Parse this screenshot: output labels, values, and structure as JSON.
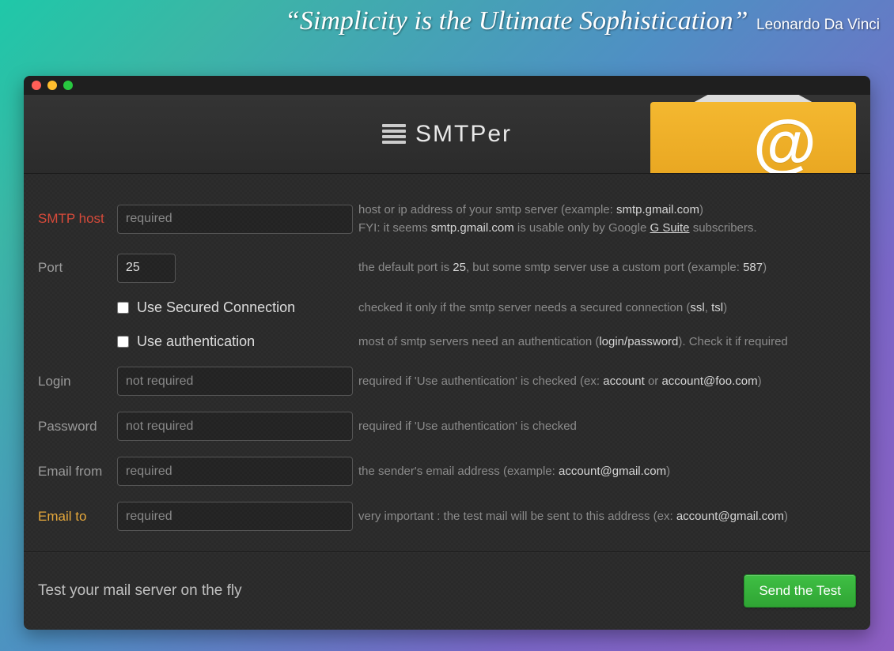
{
  "quote": {
    "text": "“Simplicity is the Ultimate Sophistication”",
    "author": "Leonardo Da Vinci"
  },
  "brand": {
    "name_html_prefix": "SMT",
    "name_html_suffix": "Per"
  },
  "icons": {
    "envelope_glyph": "@"
  },
  "fields": {
    "smtp_host": {
      "label": "SMTP host",
      "placeholder": "required",
      "help_pre": "host or ip address of your smtp server (example: ",
      "help_ex": "smtp.gmail.com",
      "help_post": ")",
      "fyi_pre": "FYI: it seems ",
      "fyi_host": "smtp.gmail.com",
      "fyi_mid": " is usable only by Google ",
      "fyi_link": "G Suite",
      "fyi_post": " subscribers."
    },
    "port": {
      "label": "Port",
      "value": "25",
      "help_pre": "the default port is ",
      "help_25": "25",
      "help_mid": ", but some smtp server use a custom port (example: ",
      "help_587": "587",
      "help_post": ")"
    },
    "secure": {
      "label": "Use Secured Connection",
      "help_pre": "checked it only if the smtp server needs a secured connection (",
      "help_ssl": "ssl",
      "help_sep": ", ",
      "help_tsl": "tsl",
      "help_post": ")"
    },
    "auth": {
      "label": "Use authentication",
      "help_pre": "most of smtp servers need an authentication (",
      "help_lp": "login/password",
      "help_post": "). Check it if required"
    },
    "login": {
      "label": "Login",
      "placeholder": "not required",
      "help_pre": "required if 'Use authentication' is checked (ex: ",
      "help_ex1": "account",
      "help_or": " or ",
      "help_ex2": "account@foo.com",
      "help_post": ")"
    },
    "password": {
      "label": "Password",
      "placeholder": "not required",
      "help": "required if 'Use authentication' is checked"
    },
    "email_from": {
      "label": "Email from",
      "placeholder": "required",
      "help_pre": "the sender's email address (example: ",
      "help_ex": "account@gmail.com",
      "help_post": ")"
    },
    "email_to": {
      "label": "Email to",
      "placeholder": "required",
      "help_pre": "very important : the test mail will be sent to this address (ex: ",
      "help_ex": "account@gmail.com",
      "help_post": ")"
    }
  },
  "footer": {
    "cta": "Test your mail server on the fly",
    "button": "Send the Test"
  }
}
